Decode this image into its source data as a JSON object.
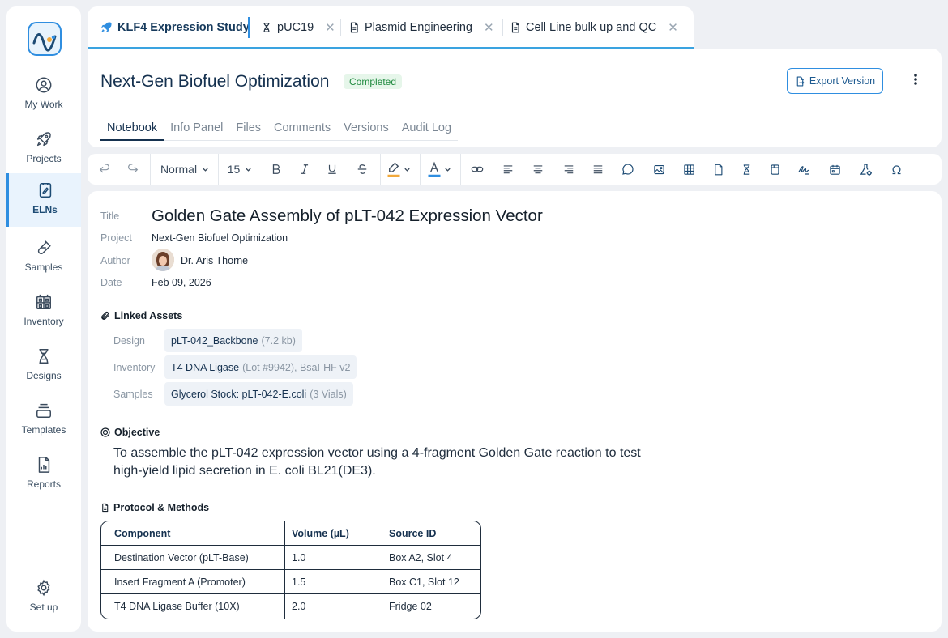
{
  "sidebar": {
    "items": [
      {
        "label": "My Work",
        "icon": "user-circle-icon"
      },
      {
        "label": "Projects",
        "icon": "rocket-icon"
      },
      {
        "label": "ELNs",
        "icon": "notebook-icon"
      },
      {
        "label": "Samples",
        "icon": "test-tube-icon"
      },
      {
        "label": "Inventory",
        "icon": "inventory-icon"
      },
      {
        "label": "Designs",
        "icon": "dna-icon"
      },
      {
        "label": "Templates",
        "icon": "templates-icon"
      },
      {
        "label": "Reports",
        "icon": "report-icon"
      }
    ],
    "setup_label": "Set up",
    "active_item": "ELNs"
  },
  "tabs": [
    {
      "label": "KLF4 Expression Study",
      "icon": "rocket-icon"
    },
    {
      "label": "pUC19",
      "icon": "dna-icon"
    },
    {
      "label": "Plasmid Engineering",
      "icon": "document-icon"
    },
    {
      "label": "Cell Line bulk up and QC",
      "icon": "document-icon"
    }
  ],
  "header": {
    "title": "Next-Gen Biofuel Optimization",
    "status": "Completed",
    "export_label": "Export Version",
    "subtabs": [
      "Notebook",
      "Info Panel",
      "Files",
      "Comments",
      "Versions",
      "Audit Log"
    ]
  },
  "toolbar": {
    "style": "Normal",
    "font_size": "15"
  },
  "entry": {
    "labels": {
      "title": "Title",
      "project": "Project",
      "author": "Author",
      "date": "Date"
    },
    "title": "Golden Gate Assembly of pLT-042 Expression Vector",
    "project": "Next-Gen Biofuel Optimization",
    "author": "Dr. Aris Thorne",
    "date": "Feb 09, 2026"
  },
  "linked_assets": {
    "heading": "Linked Assets",
    "rows": [
      {
        "label": "Design",
        "name": "pLT-042_Backbone",
        "detail": "(7.2 kb)"
      },
      {
        "label": "Inventory",
        "name": "T4 DNA Ligase",
        "detail": "(Lot #9942), BsaI-HF v2"
      },
      {
        "label": "Samples",
        "name": "Glycerol Stock: pLT-042-E.coli",
        "detail": "(3 Vials)"
      }
    ]
  },
  "objective": {
    "heading": "Objective",
    "text": "To assemble the pLT-042 expression vector using a 4-fragment Golden Gate reaction to test high-yield lipid secretion in E. coli BL21(DE3)."
  },
  "protocol": {
    "heading": "Protocol & Methods",
    "columns": [
      "Component",
      "Volume (µL)",
      "Source ID"
    ],
    "rows": [
      [
        "Destination Vector (pLT-Base)",
        "1.0",
        "Box A2, Slot 4"
      ],
      [
        "Insert Fragment A (Promoter)",
        "1.5",
        "Box C1, Slot 12"
      ],
      [
        "T4 DNA Ligase Buffer (10X)",
        "2.0",
        "Fridge 02"
      ]
    ]
  },
  "colors": {
    "accent": "#2f8ee0",
    "status_green": "#1f8a3f",
    "navy": "#15314f"
  }
}
